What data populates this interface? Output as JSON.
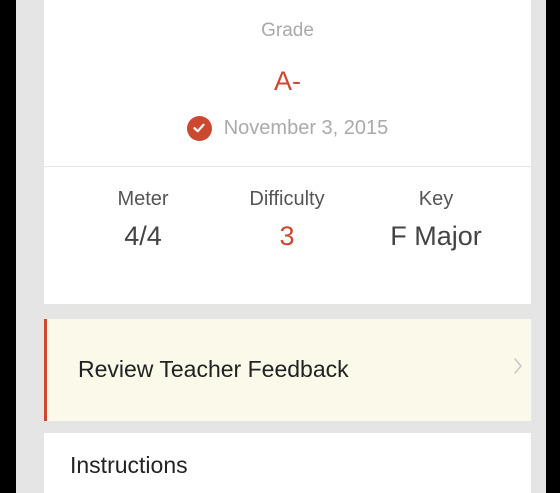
{
  "grade": {
    "label": "Grade",
    "value": "A-",
    "date": "November 3, 2015",
    "status_icon": "check-circle-icon"
  },
  "stats": [
    {
      "label": "Meter",
      "value": "4/4"
    },
    {
      "label": "Difficulty",
      "value": "3"
    },
    {
      "label": "Key",
      "value": "F Major"
    }
  ],
  "feedback": {
    "label": "Review Teacher Feedback",
    "icon": "chevron-right-icon"
  },
  "instructions": {
    "label": "Instructions"
  },
  "colors": {
    "accent": "#cc4830",
    "background": "#e5e5e5",
    "feedback_bg": "#fbf9e9"
  }
}
